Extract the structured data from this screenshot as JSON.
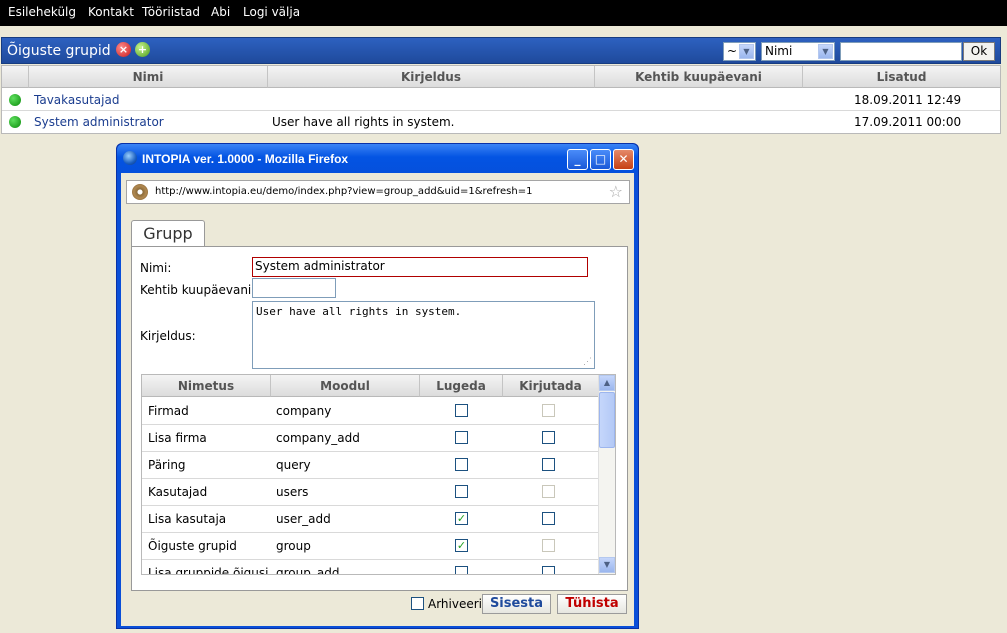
{
  "topnav": {
    "items": [
      "Esilehekülg",
      "Kontakt",
      "Tööriistad",
      "Abi",
      "Logi välja"
    ]
  },
  "header": {
    "title": "Õiguste grupid",
    "operator_select": "~",
    "field_select": "Nimi",
    "search_value": "",
    "ok_label": "Ok"
  },
  "groups_table": {
    "columns": [
      "Nimi",
      "Kirjeldus",
      "Kehtib kuupäevani",
      "Lisatud"
    ],
    "rows": [
      {
        "name": "Tavakasutajad",
        "description": "",
        "valid_until": "",
        "added": "18.09.2011 12:49"
      },
      {
        "name": "System administrator",
        "description": "User have all rights in system.",
        "valid_until": "",
        "added": "17.09.2011 00:00"
      }
    ]
  },
  "popup": {
    "title": "INTOPIA ver. 1.0000 - Mozilla Firefox",
    "url": "http://www.intopia.eu/demo/index.php?view=group_add&uid=1&refresh=1",
    "tab_label": "Grupp",
    "form": {
      "name_label": "Nimi:",
      "name_value": "System administrator",
      "valid_label": "Kehtib kuupäevani:",
      "valid_value": "",
      "desc_label": "Kirjeldus:",
      "desc_value": "User have all rights in system."
    },
    "grid": {
      "columns": [
        "Nimetus",
        "Moodul",
        "Lugeda",
        "Kirjutada"
      ],
      "rows": [
        {
          "name": "Firmad",
          "module": "company",
          "read": false,
          "write": false,
          "write_enabled": false
        },
        {
          "name": "Lisa firma",
          "module": "company_add",
          "read": false,
          "write": false,
          "write_enabled": true
        },
        {
          "name": "Päring",
          "module": "query",
          "read": false,
          "write": false,
          "write_enabled": true
        },
        {
          "name": "Kasutajad",
          "module": "users",
          "read": false,
          "write": false,
          "write_enabled": false
        },
        {
          "name": "Lisa kasutaja",
          "module": "user_add",
          "read": true,
          "write": false,
          "write_enabled": true
        },
        {
          "name": "Õiguste grupid",
          "module": "group",
          "read": true,
          "write": false,
          "write_enabled": false
        },
        {
          "name": "Lisa gruppide õigusi",
          "module": "group_add",
          "read": false,
          "write": false,
          "write_enabled": true
        }
      ]
    },
    "footer": {
      "archive_label": "Arhiveeri",
      "submit_label": "Sisesta",
      "cancel_label": "Tühista"
    }
  },
  "colors": {
    "header_blue": "#1f4a9c",
    "link": "#1b3d8f",
    "cancel_red": "#c00000",
    "submit_blue": "#1f4a9c",
    "status_green": "#0a8a0a"
  }
}
